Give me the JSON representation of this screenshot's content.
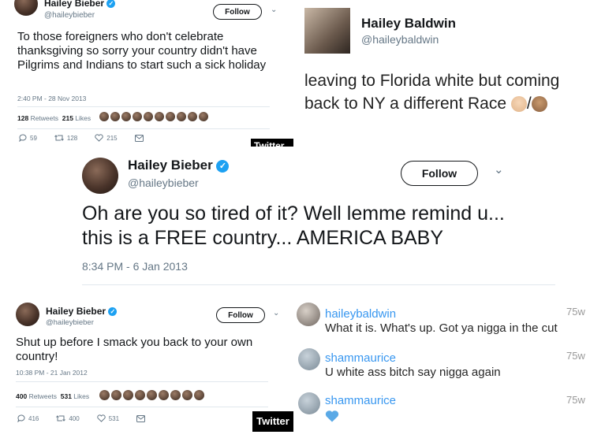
{
  "tweet1": {
    "name": "Hailey Bieber",
    "handle": "@haileybieber",
    "follow_label": "Follow",
    "text": "To those foreigners who don't celebrate thanksgiving so sorry your country didn't have Pilgrims and Indians to start such a sick holiday",
    "timestamp": "2:40 PM - 28 Nov 2013",
    "retweets_count": "128",
    "retweets_label": "Retweets",
    "likes_count": "215",
    "likes_label": "Likes",
    "replies": "59",
    "retweets_action": "128",
    "likes_action": "215",
    "tag": "Twitter"
  },
  "post2": {
    "name": "Hailey Baldwin",
    "handle": "@haileybaldwin",
    "text": "leaving to Florida white but coming back to NY a different Race",
    "separator": "/"
  },
  "tweet3": {
    "name": "Hailey Bieber",
    "handle": "@haileybieber",
    "follow_label": "Follow",
    "text": "Oh are you so tired of it? Well lemme remind u... this is a FREE country... AMERICA BABY",
    "timestamp": "8:34 PM - 6 Jan 2013"
  },
  "tweet4": {
    "name": "Hailey Bieber",
    "handle": "@haileybieber",
    "follow_label": "Follow",
    "text": "Shut up before I smack you back to your own country!",
    "timestamp": "10:38 PM - 21 Jan 2012",
    "retweets_count": "400",
    "retweets_label": "Retweets",
    "likes_count": "531",
    "likes_label": "Likes",
    "replies": "416",
    "retweets_action": "400",
    "likes_action": "531",
    "tag": "Twitter"
  },
  "instagram": {
    "comments": [
      {
        "user": "haileybaldwin",
        "text": "What it is. What's up. Got ya nigga in the cut",
        "time": "75w"
      },
      {
        "user": "shammaurice",
        "text": "U white ass bitch say nigga again",
        "time": "75w"
      },
      {
        "user": "shammaurice",
        "text": "",
        "time": "75w",
        "emoji": "blue-heart"
      }
    ]
  },
  "colors": {
    "verified": "#1da1f2",
    "ig_username": "#3897f0",
    "muted": "#657786"
  }
}
